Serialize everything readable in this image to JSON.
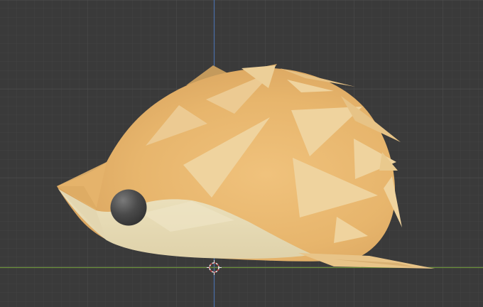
{
  "viewport": {
    "background": "#3a3a3a",
    "grid_minor_color": "#434343",
    "grid_major_color": "#4e4e4e",
    "axis_x_color": "#6a8f3a",
    "axis_z_color": "#4a6fa8",
    "view": "orthographic-side"
  },
  "model": {
    "subject": "hedgehog",
    "body_color": "#e6b46a",
    "belly_color": "#e8dcb6",
    "spike_color": "#e9c98d",
    "eye_color": "#4a4a4a"
  },
  "origin_cursor": {
    "icon": "3d-cursor-icon"
  }
}
